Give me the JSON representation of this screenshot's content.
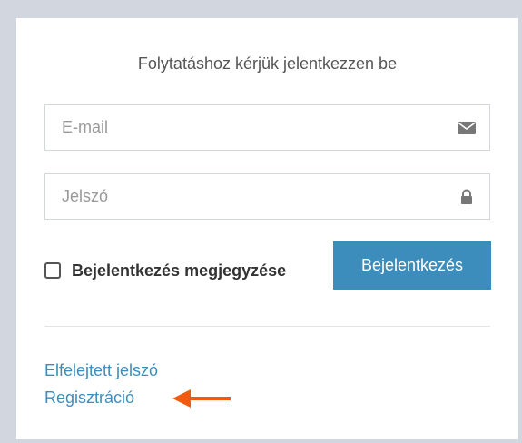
{
  "login_box": {
    "subtitle": "Folytatáshoz kérjük jelentkezzen be",
    "email": {
      "placeholder": "E-mail",
      "value": "",
      "icon": "envelope-icon"
    },
    "password": {
      "placeholder": "Jelszó",
      "value": "",
      "icon": "lock-icon"
    },
    "remember_me": {
      "label": "Bejelentkezés megjegyzése",
      "checked": false
    },
    "login_button": "Bejelentkezés",
    "forgot_password_link": "Elfelejtett jelszó",
    "register_link": "Regisztráció",
    "annotation": {
      "icon": "arrow-left-icon",
      "color": "#f15a0f"
    }
  },
  "colors": {
    "background": "#d2d6de",
    "primary": "#3c8dbc",
    "text": "#555555",
    "annotation_arrow": "#f15a0f"
  }
}
